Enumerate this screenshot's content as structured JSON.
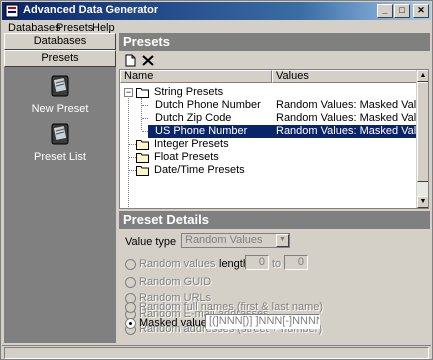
{
  "window": {
    "title": "Advanced Data Generator"
  },
  "menu": [
    "Databases",
    "Presets",
    "Help"
  ],
  "sidebar": {
    "tabs": [
      "Databases",
      "Presets"
    ],
    "items": [
      {
        "label": "New Preset",
        "icon": "new-preset-icon"
      },
      {
        "label": "Preset List",
        "icon": "preset-list-icon"
      }
    ]
  },
  "presets_panel": {
    "header": "Presets",
    "columns": [
      "Name",
      "Values"
    ],
    "tree": [
      {
        "name": "String Presets",
        "expanded": true,
        "children": [
          {
            "name": "Dutch Phone Number",
            "value": "Random Values: Masked Values"
          },
          {
            "name": "Dutch Zip Code",
            "value": "Random Values: Masked Values"
          },
          {
            "name": "US Phone Number",
            "value": "Random Values: Masked Values",
            "selected": true
          }
        ]
      },
      {
        "name": "Integer Presets"
      },
      {
        "name": "Float Presets"
      },
      {
        "name": "Date/Time Presets"
      }
    ]
  },
  "details": {
    "header": "Preset Details",
    "value_type_label": "Value type",
    "value_type": "Random Values",
    "length_label": "length",
    "length_from": "0",
    "to_label": "to",
    "length_to": "0",
    "options": [
      {
        "label": "Random values",
        "checked": false
      },
      {
        "label": "Random GUID",
        "checked": false
      },
      {
        "label": "Random URLs",
        "checked": false
      },
      {
        "label": "Random E-mail addresses",
        "checked": false
      },
      {
        "label": "Random addresses (street + number)",
        "checked": false
      },
      {
        "label": "Random full names (first & last name)",
        "checked": false
      },
      {
        "label": "Masked values:",
        "checked": true
      }
    ],
    "mask": "[(]NNN[)] ]NNN[-]NNNN"
  },
  "colors": {
    "selection": "#0a246a",
    "panel_header": "#808080",
    "face": "#d4d0c8"
  }
}
